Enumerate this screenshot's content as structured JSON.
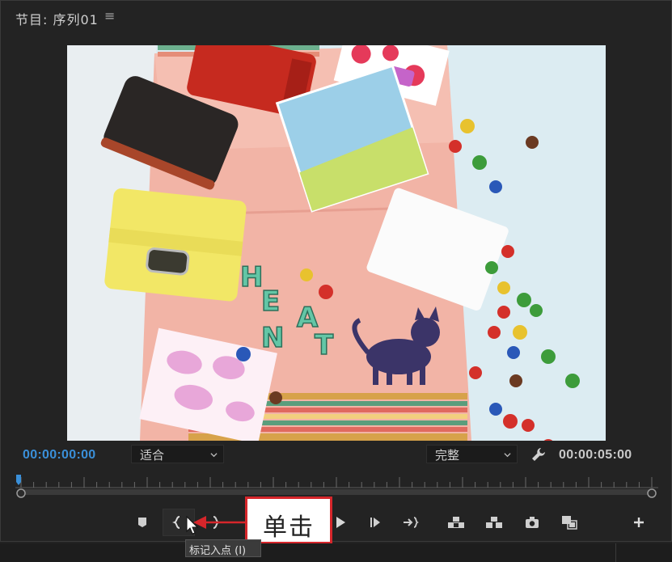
{
  "panel": {
    "title": "节目: 序列01",
    "menu_icon": "hamburger-icon",
    "accent_color": "#3a8fd8"
  },
  "timecodes": {
    "current": "00:00:00:00",
    "duration": "00:00:05:00"
  },
  "zoom_dropdown": {
    "value": "适合"
  },
  "quality_dropdown": {
    "value": "完整"
  },
  "preview": {
    "letters": [
      "H",
      "E",
      "A",
      "N",
      "T"
    ]
  },
  "playhead": {
    "position": 0
  },
  "transport_buttons": [
    {
      "name": "add-marker",
      "icon": "marker-icon"
    },
    {
      "name": "mark-in",
      "icon": "mark-in-icon"
    },
    {
      "name": "mark-out",
      "icon": "mark-out-icon"
    },
    {
      "name": "go-to-in",
      "icon": "go-to-in-icon"
    },
    {
      "name": "step-back",
      "icon": "step-back-icon"
    },
    {
      "name": "play",
      "icon": "play-icon"
    },
    {
      "name": "step-forward",
      "icon": "step-forward-icon"
    },
    {
      "name": "go-to-out",
      "icon": "go-to-out-icon"
    },
    {
      "name": "lift",
      "icon": "lift-icon"
    },
    {
      "name": "extract",
      "icon": "extract-icon"
    },
    {
      "name": "export-frame",
      "icon": "camera-icon"
    },
    {
      "name": "comparison-view",
      "icon": "comparison-icon"
    },
    {
      "name": "button-editor",
      "icon": "plus-icon"
    }
  ],
  "callout": {
    "text": "单击",
    "color": "#d6262b"
  },
  "tooltip": {
    "text": "标记入点 (I)"
  }
}
